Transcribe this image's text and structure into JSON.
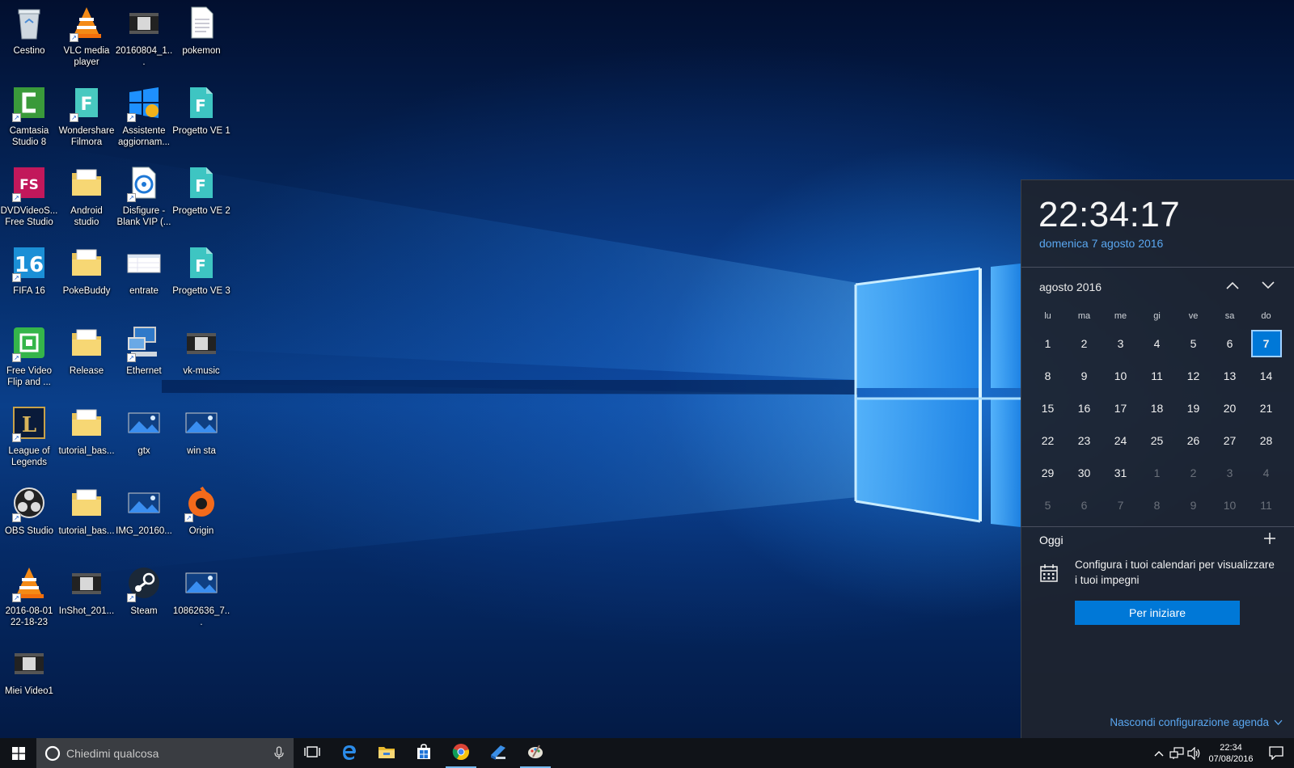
{
  "desktop": {
    "icons": [
      {
        "label": "Cestino",
        "icon": "recycle-bin-icon"
      },
      {
        "label": "VLC media player",
        "icon": "vlc-icon"
      },
      {
        "label": "20160804_1...",
        "icon": "video-file-icon"
      },
      {
        "label": "pokemon",
        "icon": "text-file-icon"
      },
      {
        "label": "Camtasia Studio 8",
        "icon": "camtasia-icon"
      },
      {
        "label": "Wondershare Filmora",
        "icon": "filmora-icon"
      },
      {
        "label": "Assistente aggiornam...",
        "icon": "windows-update-assistant-icon"
      },
      {
        "label": "Progetto VE 1",
        "icon": "filmora-project-icon"
      },
      {
        "label": "DVDVideoS... Free Studio",
        "icon": "dvdvideosoft-icon"
      },
      {
        "label": "Android studio",
        "icon": "folder-icon"
      },
      {
        "label": "Disfigure - Blank VIP (...",
        "icon": "audio-file-icon"
      },
      {
        "label": "Progetto VE 2",
        "icon": "filmora-project-icon"
      },
      {
        "label": "FIFA 16",
        "icon": "fifa-icon"
      },
      {
        "label": "PokeBuddy",
        "icon": "folder-icon"
      },
      {
        "label": "entrate",
        "icon": "spreadsheet-icon"
      },
      {
        "label": "Progetto VE 3",
        "icon": "filmora-project-icon"
      },
      {
        "label": "Free Video Flip and ...",
        "icon": "video-flip-icon"
      },
      {
        "label": "Release",
        "icon": "folder-icon"
      },
      {
        "label": "Ethernet",
        "icon": "network-icon"
      },
      {
        "label": "vk-music",
        "icon": "video-file-icon"
      },
      {
        "label": "League of Legends",
        "icon": "league-of-legends-icon"
      },
      {
        "label": "tutorial_bas...",
        "icon": "folder-icon"
      },
      {
        "label": "gtx",
        "icon": "image-file-icon"
      },
      {
        "label": "win sta",
        "icon": "image-file-icon"
      },
      {
        "label": "OBS Studio",
        "icon": "obs-icon"
      },
      {
        "label": "tutorial_bas...",
        "icon": "folder-icon"
      },
      {
        "label": "IMG_20160...",
        "icon": "image-file-icon"
      },
      {
        "label": "Origin",
        "icon": "origin-icon"
      },
      {
        "label": "2016-08-01 22-18-23",
        "icon": "vlc-icon"
      },
      {
        "label": "InShot_201...",
        "icon": "video-file-icon"
      },
      {
        "label": "Steam",
        "icon": "steam-icon"
      },
      {
        "label": "10862636_7...",
        "icon": "image-file-icon"
      },
      {
        "label": "Miei Video1",
        "icon": "video-file-icon"
      }
    ]
  },
  "flyout": {
    "time": "22:34:17",
    "date": "domenica 7 agosto 2016",
    "month_label": "agosto 2016",
    "weekdays": [
      "lu",
      "ma",
      "me",
      "gi",
      "ve",
      "sa",
      "do"
    ],
    "weeks": [
      [
        "1",
        "2",
        "3",
        "4",
        "5",
        "6",
        "7"
      ],
      [
        "8",
        "9",
        "10",
        "11",
        "12",
        "13",
        "14"
      ],
      [
        "15",
        "16",
        "17",
        "18",
        "19",
        "20",
        "21"
      ],
      [
        "22",
        "23",
        "24",
        "25",
        "26",
        "27",
        "28"
      ],
      [
        "29",
        "30",
        "31",
        "1",
        "2",
        "3",
        "4"
      ],
      [
        "5",
        "6",
        "7",
        "8",
        "9",
        "10",
        "11"
      ]
    ],
    "today_day": "7",
    "agenda_title": "Oggi",
    "config_text": "Configura i tuoi calendari per visualizzare i tuoi impegni",
    "start_button": "Per iniziare",
    "hide_agenda": "Nascondi configurazione agenda"
  },
  "taskbar": {
    "search_placeholder": "Chiedimi qualcosa",
    "apps": [
      {
        "name": "task-view-icon",
        "active": false
      },
      {
        "name": "edge-icon",
        "active": false
      },
      {
        "name": "file-explorer-icon",
        "active": false
      },
      {
        "name": "store-icon",
        "active": false
      },
      {
        "name": "chrome-icon",
        "active": true
      },
      {
        "name": "remote-desktop-icon",
        "active": false
      },
      {
        "name": "paint-icon",
        "active": true
      }
    ],
    "clock_time": "22:34",
    "clock_date": "07/08/2016"
  },
  "colors": {
    "accent": "#0078d7",
    "date_link": "#5aa7f0",
    "taskbar": "#101318",
    "flyout_bg": "#1e242e"
  }
}
